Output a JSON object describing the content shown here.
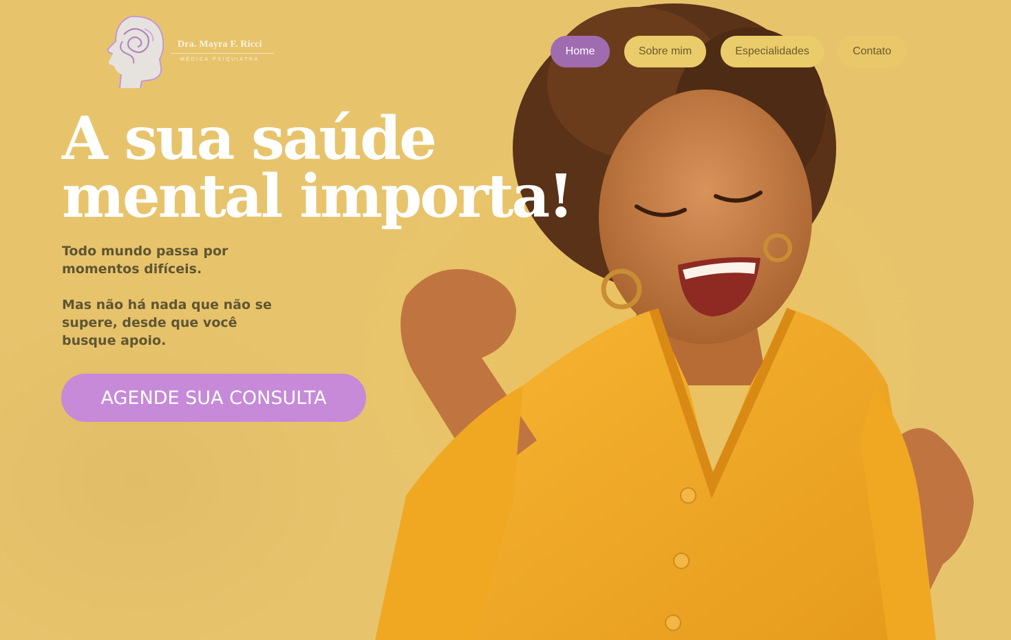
{
  "colors": {
    "background": "#e7c46c",
    "accent_purple": "#a06cb0",
    "cta_purple": "#c68ad8",
    "nav_pill": "#ebcc6a",
    "body_text": "#5f5532"
  },
  "brand": {
    "logo_icon": "head-brain-icon",
    "name": "Dra. Mayra F. Ricci",
    "role": "MÉDICA PSIQUIATRA"
  },
  "nav": {
    "items": [
      {
        "label": "Home",
        "active": true
      },
      {
        "label": "Sobre mim",
        "active": false
      },
      {
        "label": "Especialidades",
        "active": false
      },
      {
        "label": "Contato",
        "active": false
      }
    ]
  },
  "hero": {
    "title_line1": "A sua saúde",
    "title_line2": "mental importa!",
    "paragraph1": "Todo mundo passa por momentos difíceis.",
    "paragraph2": "Mas não há nada que não se supere, desde que você busque apoio.",
    "cta_label": "AGENDE SUA CONSULTA",
    "image_subject": "smiling woman in yellow cardigan"
  }
}
